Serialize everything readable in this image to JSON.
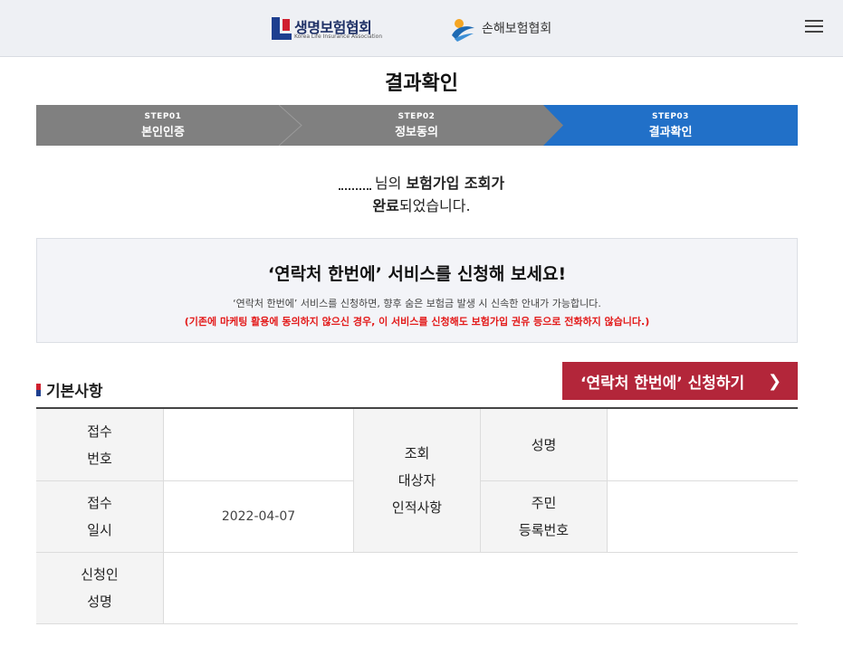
{
  "header": {
    "logo1_name": "생명보험협회",
    "logo1_sub": "Korea Life Insurance Association",
    "logo2_name": "손해보험협회"
  },
  "page_title": "결과확인",
  "steps": [
    {
      "label": "STEP01",
      "name": "본인인증",
      "active": false
    },
    {
      "label": "STEP02",
      "name": "정보동의",
      "active": false
    },
    {
      "label": "STEP03",
      "name": "결과확인",
      "active": true
    }
  ],
  "result": {
    "line1_suffix": "님의",
    "line1_bold": "보험가입 조회가",
    "line2_bold": "완료",
    "line2_rest": "되었습니다."
  },
  "promo": {
    "title": "‘연락처 한번에’ 서비스를 신청해 보세요!",
    "desc": "‘연락처 한번에’ 서비스를 신청하면, 향후 숨은 보험금 발생 시 신속한 안내가 가능합니다.",
    "warning": "(기존에 마케팅 활용에 동의하지 않으신 경우, 이 서비스를 신청해도 보험가입 권유 등으로 전화하지 않습니다.)"
  },
  "basic": {
    "section_title": "기본사항",
    "apply_button": "‘연락처 한번에’ 신청하기",
    "receipt_no_label_1": "접수",
    "receipt_no_label_2": "번호",
    "receipt_no_value": "",
    "receipt_date_label_1": "접수",
    "receipt_date_label_2": "일시",
    "receipt_date_value": "2022-04-07",
    "subject_label_1": "조회",
    "subject_label_2": "대상자",
    "subject_label_3": "인적사항",
    "name_label": "성명",
    "name_value": "",
    "rrn_label_1": "주민",
    "rrn_label_2": "등록번호",
    "rrn_value": "",
    "applicant_label_1": "신청인",
    "applicant_label_2": "성명",
    "applicant_value": ""
  },
  "colors": {
    "step_active": "#2170c8",
    "step_inactive": "#808080",
    "apply_button": "#b3263a",
    "warning_text": "#e31a1a"
  }
}
